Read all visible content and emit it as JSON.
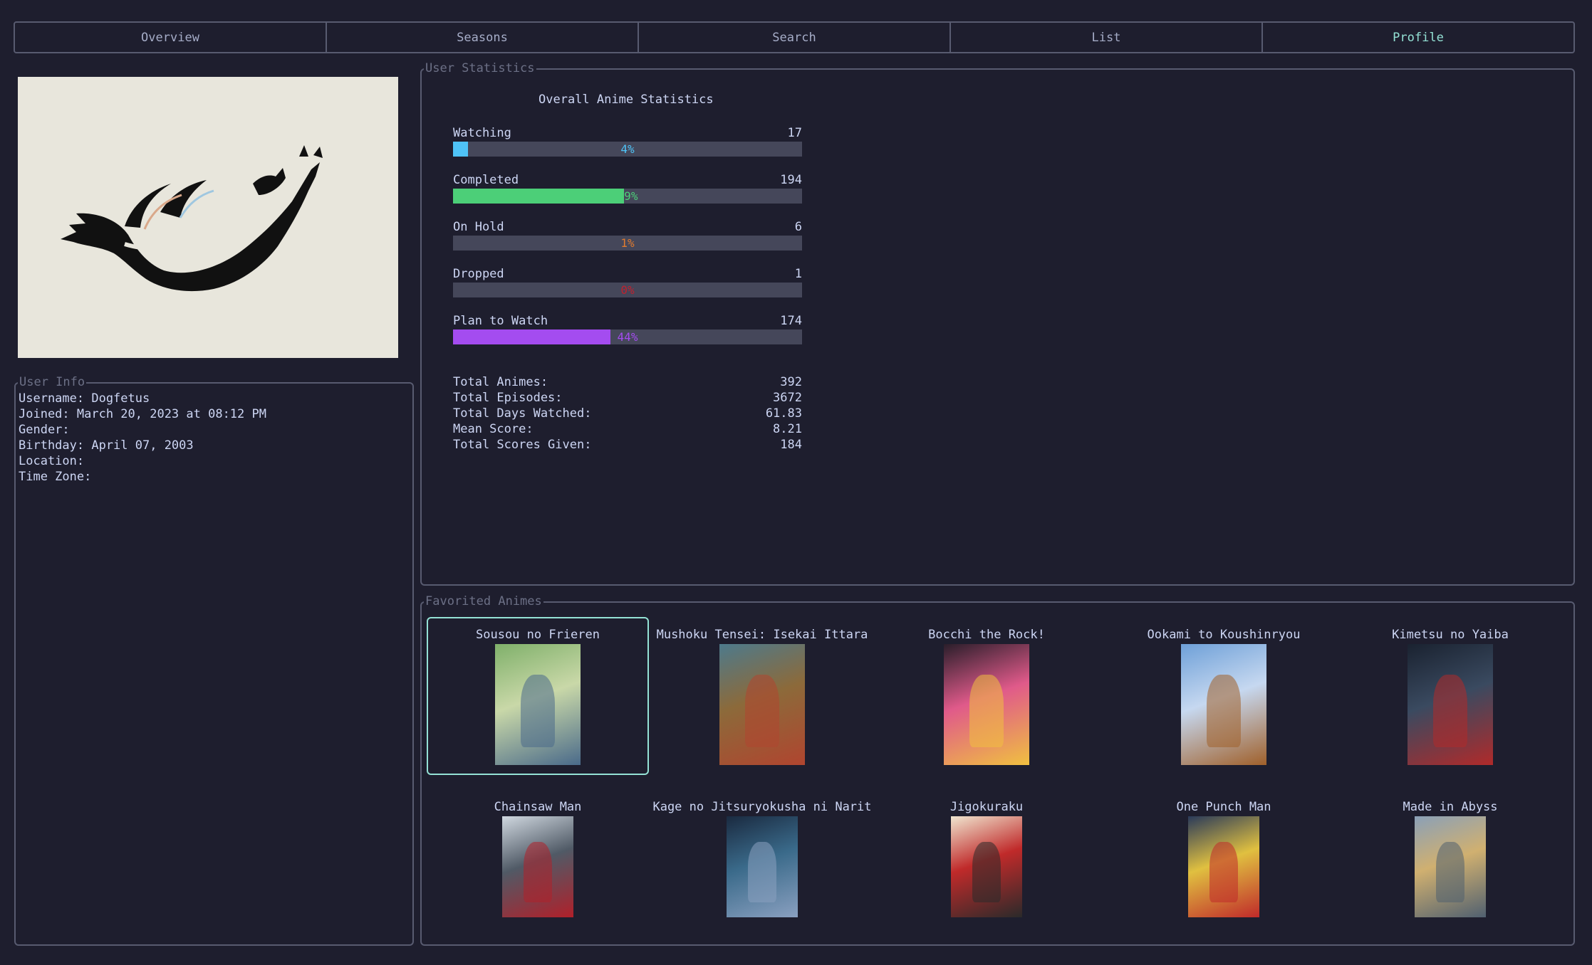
{
  "tabs": [
    {
      "label": "Overview",
      "active": false
    },
    {
      "label": "Seasons",
      "active": false
    },
    {
      "label": "Search",
      "active": false
    },
    {
      "label": "List",
      "active": false
    },
    {
      "label": "Profile",
      "active": true
    }
  ],
  "avatar": {
    "icon": "leaping-cat-silhouette",
    "background": "#e8e6dc"
  },
  "user_info": {
    "legend": "User Info",
    "lines": [
      "Username: Dogfetus",
      "Joined: March 20, 2023 at 08:12 PM",
      "Gender:",
      "Birthday: April 07, 2003",
      "Location:",
      "Time Zone:"
    ]
  },
  "stats": {
    "legend": "User Statistics",
    "title": "Overall Anime Statistics",
    "bars": [
      {
        "label": "Watching",
        "count": "17",
        "percent_label": "4%",
        "fraction": 0.043,
        "color": "#4fc3f7"
      },
      {
        "label": "Completed",
        "count": "194",
        "percent_label": "49%",
        "fraction": 0.49,
        "color": "#4ccf78"
      },
      {
        "label": "On Hold",
        "count": "6",
        "percent_label": "1%",
        "fraction": 0.0,
        "color": "#e07b2f"
      },
      {
        "label": "Dropped",
        "count": "1",
        "percent_label": "0%",
        "fraction": 0.0,
        "color": "#c0212f"
      },
      {
        "label": "Plan to Watch",
        "count": "174",
        "percent_label": "44%",
        "fraction": 0.45,
        "color": "#a44cf0"
      }
    ],
    "totals": [
      {
        "label": "Total Animes:",
        "value": "392"
      },
      {
        "label": "Total Episodes:",
        "value": "3672"
      },
      {
        "label": "Total Days Watched:",
        "value": "61.83"
      },
      {
        "label": "Mean Score:",
        "value": "8.21"
      },
      {
        "label": "Total Scores Given:",
        "value": "184"
      }
    ]
  },
  "favorites": {
    "legend": "Favorited Animes",
    "items": [
      {
        "title": "Sousou no Frieren",
        "selected": true,
        "colors": [
          "#7fb06a",
          "#c9d8a8",
          "#4a6a8a"
        ]
      },
      {
        "title": "Mushoku Tensei: Isekai Ittara",
        "selected": false,
        "colors": [
          "#4d7a8c",
          "#8c6a3a",
          "#b0452f"
        ]
      },
      {
        "title": "Bocchi the Rock!",
        "selected": false,
        "colors": [
          "#2a1e2a",
          "#e05a8a",
          "#f0c040"
        ]
      },
      {
        "title": "Ookami to Koushinryou",
        "selected": false,
        "colors": [
          "#6ea0d8",
          "#c6d8f0",
          "#a0602a"
        ]
      },
      {
        "title": "Kimetsu no Yaiba",
        "selected": false,
        "colors": [
          "#1a2230",
          "#3a4a60",
          "#b02a2a"
        ]
      },
      {
        "title": "Chainsaw Man",
        "selected": false,
        "colors": [
          "#d0d8e0",
          "#505a66",
          "#b0202a"
        ]
      },
      {
        "title": "Kage no Jitsuryokusha ni Narit",
        "selected": false,
        "colors": [
          "#1a2a40",
          "#3a6a8a",
          "#8aa0c0"
        ]
      },
      {
        "title": "Jigokuraku",
        "selected": false,
        "colors": [
          "#f0e6d0",
          "#c02a2a",
          "#2a2a2a"
        ]
      },
      {
        "title": "One Punch Man",
        "selected": false,
        "colors": [
          "#2a3a5a",
          "#e0c040",
          "#c02a2a"
        ]
      },
      {
        "title": "Made in Abyss",
        "selected": false,
        "colors": [
          "#8aa0b8",
          "#d0b070",
          "#506070"
        ]
      }
    ]
  }
}
